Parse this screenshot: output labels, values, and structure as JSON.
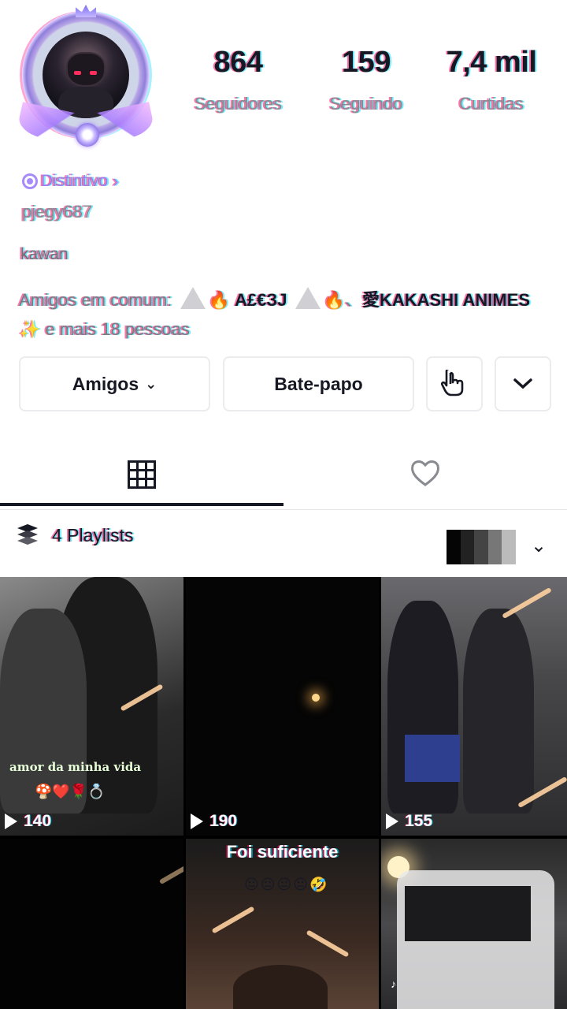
{
  "profile": {
    "stats": [
      {
        "value": "864",
        "label": "Seguidores"
      },
      {
        "value": "159",
        "label": "Seguindo"
      },
      {
        "value": "7,4 mil",
        "label": "Curtidas"
      }
    ],
    "badge_label": "Distintivo",
    "badge_chevron": "›",
    "username": "pjegy687",
    "bio": "kawan",
    "mutual_prefix": "Amigos em comum:",
    "mutual_name_1": "A£€ЗЈ",
    "mutual_name_2": "愛KAKASHI ANIMES",
    "mutual_suffix": "e mais 18 pessoas"
  },
  "actions": {
    "friends_label": "Amigos",
    "friends_caret": "⌄",
    "chat_label": "Bate-papo",
    "share_icon": "share-hand-icon",
    "more_icon": "chevron-down-icon",
    "more_glyph": "⌄"
  },
  "tabs": [
    {
      "icon": "grid-icon",
      "active": true
    },
    {
      "icon": "heart-icon",
      "active": false
    }
  ],
  "playlists": {
    "label": "4 Playlists",
    "caret": "⌄"
  },
  "videos": [
    {
      "views": "140",
      "caption": "amor da minha vida"
    },
    {
      "views": "190",
      "caption": ""
    },
    {
      "views": "155",
      "caption": ""
    },
    {
      "views": "",
      "caption": ""
    },
    {
      "views": "",
      "caption": "Foi suficiente"
    },
    {
      "views": "",
      "caption": ""
    }
  ],
  "colors": {
    "text_primary": "#161823",
    "text_secondary": "#8a8b91",
    "badge": "#9b7ef0",
    "fire": "#ff6a00"
  }
}
